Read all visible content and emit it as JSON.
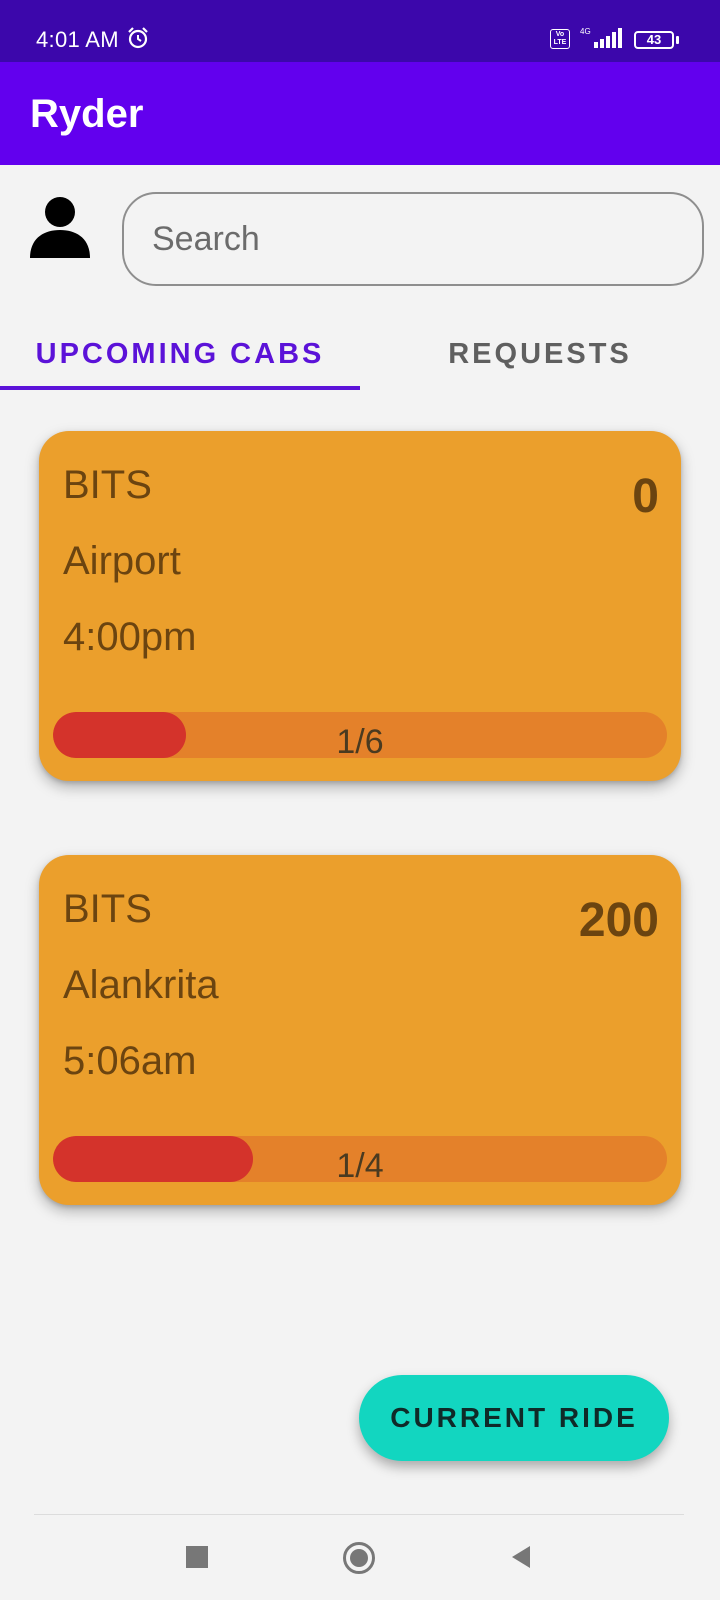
{
  "status_bar": {
    "time": "4:01 AM",
    "volte_text": "Vo LTE",
    "network": "4G",
    "battery": "43",
    "icons": [
      "alarm-icon",
      "volte-icon",
      "signal-icon",
      "battery-icon"
    ]
  },
  "app_bar": {
    "title": "Ryder"
  },
  "search": {
    "placeholder": "Search",
    "value": ""
  },
  "tabs": [
    {
      "label": "UPCOMING CABS",
      "selected": true
    },
    {
      "label": "REQUESTS",
      "selected": false
    }
  ],
  "cabs": [
    {
      "from": "BITS",
      "to": "Airport",
      "time": "4:00pm",
      "fare": "0",
      "seats_label": "1/6",
      "seats_filled": 1,
      "seats_total": 6
    },
    {
      "from": "BITS",
      "to": "Alankrita",
      "time": "5:06am",
      "fare": "200",
      "seats_label": "1/4",
      "seats_filled": 1,
      "seats_total": 4
    }
  ],
  "fab": {
    "label": "CURRENT RIDE"
  },
  "nav_bar": {
    "buttons": [
      "recents-icon",
      "home-icon",
      "back-icon"
    ]
  },
  "colors": {
    "app_bar": "#6200ee",
    "status_bar": "#3c07ab",
    "card": "#eb9f2c",
    "seat_track": "#e4812a",
    "seat_fill": "#d4332b",
    "fab": "#12d6c0",
    "tab_active": "#5b12d8"
  }
}
